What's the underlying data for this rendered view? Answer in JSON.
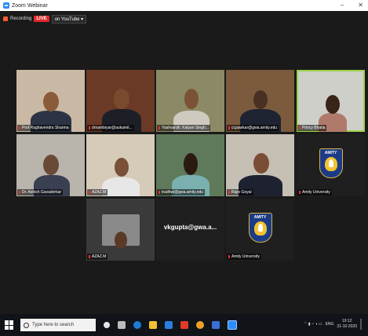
{
  "window": {
    "title": "Zoom Webinar",
    "minimize": "–",
    "close": "✕"
  },
  "toolbar": {
    "recording_label": "Recording",
    "live_label": "LIVE",
    "stream_label": "on YouTube ▾"
  },
  "participants": [
    {
      "name": "Prof Raghavendra Sharma"
    },
    {
      "name": "drnambiyar@aukamit..."
    },
    {
      "name": "Yashvardh. Kalyan Singh..."
    },
    {
      "name": "ccpawkar@gwa.amity.edu"
    },
    {
      "name": "Princy Bhatia"
    },
    {
      "name": "Dr. Ashish Gavaderkar"
    },
    {
      "name": "AZAZ.M"
    },
    {
      "name": "tradhwi@gwa.amity.edu"
    },
    {
      "name": "Rajiv Goyal"
    },
    {
      "name": "Amity University"
    },
    {
      "name": "AZAZ.M"
    },
    {
      "name": "vkgupta@gwa.a...",
      "display": "vkgupta@gwa.a..."
    },
    {
      "name": "Amity University"
    }
  ],
  "logo_text": "AMITY",
  "taskbar": {
    "search_placeholder": "Type here to search",
    "tray_lang": "ENG",
    "time": "19:12",
    "date": "31-10-2020"
  },
  "colors": {
    "meeting_bg": "#1a1a1a",
    "active_speaker": "#9bd24a",
    "live": "#e02828"
  }
}
